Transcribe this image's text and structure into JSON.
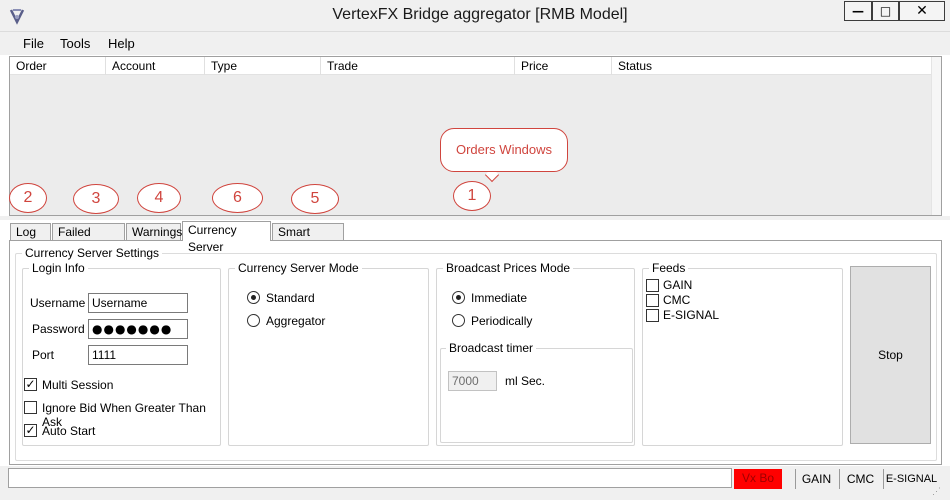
{
  "window": {
    "title": "VertexFX Bridge aggregator [RMB Model]",
    "minimize_glyph": "—",
    "maximize_glyph": "□",
    "close_glyph": "✕"
  },
  "menu": {
    "file": "File",
    "tools": "Tools",
    "help": "Help"
  },
  "orders": {
    "columns": [
      "Order",
      "Account",
      "Type",
      "Trade",
      "Price",
      "Status"
    ]
  },
  "annotations": {
    "callout": "Orders Windows",
    "badges": [
      "1",
      "2",
      "3",
      "4",
      "6",
      "5"
    ]
  },
  "tabs": [
    "Log",
    "Failed Orders",
    "Warnings",
    "Currency Server",
    "Smart Dealer"
  ],
  "active_tab": "Currency Server",
  "settings": {
    "title": "Currency Server Settings",
    "login": {
      "title": "Login Info",
      "username_label": "Username",
      "username_value": "Username",
      "password_label": "Password",
      "password_value": "●●●●●●●",
      "port_label": "Port",
      "port_value": "1111",
      "multi_session": "Multi Session",
      "multi_session_checked": true,
      "ignore_bid": "Ignore Bid When Greater Than Ask",
      "ignore_bid_checked": false,
      "auto_start": "Auto Start",
      "auto_start_checked": true
    },
    "mode": {
      "title": "Currency Server Mode",
      "standard": "Standard",
      "aggregator": "Aggregator",
      "selected": "Standard"
    },
    "broadcast": {
      "title": "Broadcast Prices Mode",
      "immediate": "Immediate",
      "periodically": "Periodically",
      "selected": "Immediate",
      "timer_title": "Broadcast timer",
      "timer_value": "7000",
      "timer_unit": "ml Sec."
    },
    "feeds": {
      "title": "Feeds",
      "items": [
        "GAIN",
        "CMC",
        "E-SIGNAL"
      ]
    },
    "stop_label": "Stop"
  },
  "status": {
    "vx": "Vx Bo",
    "gain": "GAIN",
    "cmc": "CMC",
    "esignal": "E-SIGNAL",
    "grip": "⋰"
  },
  "colors": {
    "annotation": "#d0453e",
    "status_alert": "#ff0000",
    "chrome": "#f0f0f0"
  }
}
